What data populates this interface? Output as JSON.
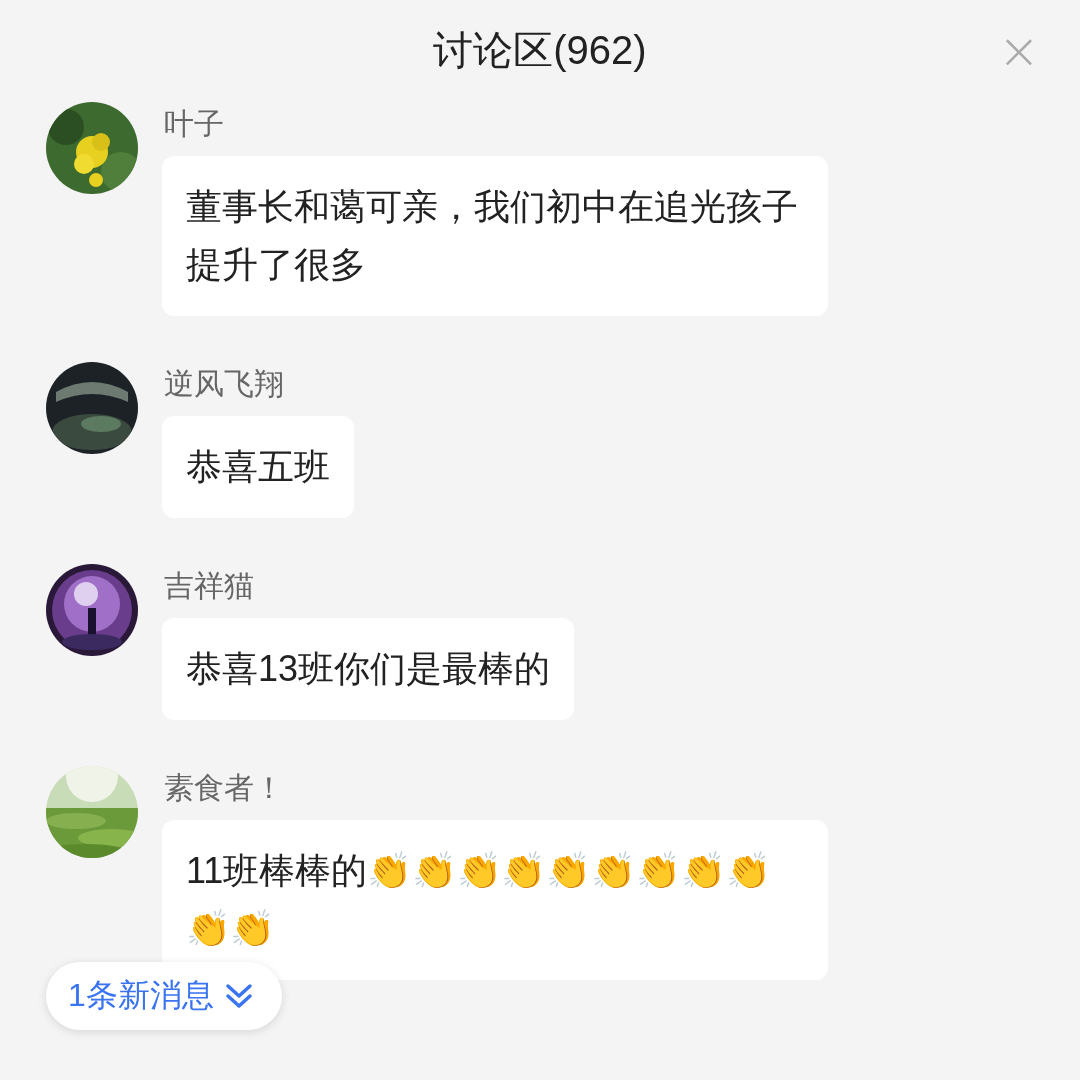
{
  "header": {
    "title": "讨论区(962)",
    "close": "×"
  },
  "messages": [
    {
      "name": "叶子",
      "text": "董事长和蔼可亲，我们初中在追光孩子提升了很多"
    },
    {
      "name": "逆风飞翔",
      "text": "恭喜五班"
    },
    {
      "name": "吉祥猫",
      "text": "恭喜13班你们是最棒的"
    },
    {
      "name": "素食者！",
      "text": "11班棒棒的👏👏👏👏👏👏👏👏👏👏👏"
    }
  ],
  "new_messages": {
    "label": "1条新消息"
  }
}
